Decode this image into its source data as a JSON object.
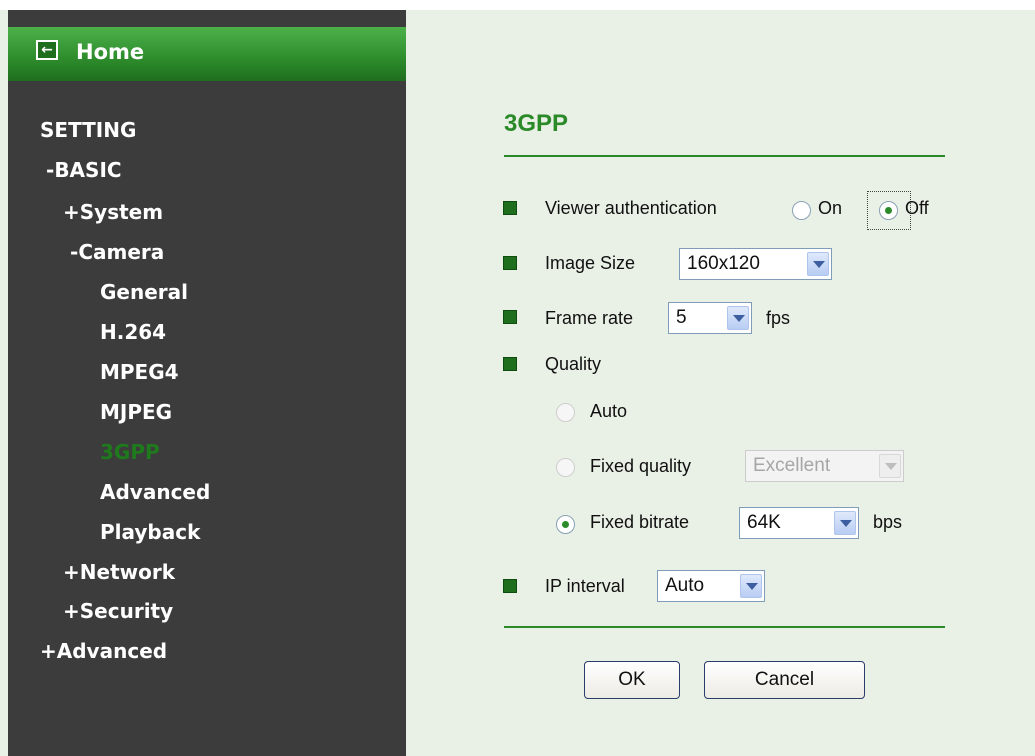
{
  "sidebar": {
    "home_label": "Home",
    "items": [
      {
        "label": "SETTING",
        "prefix": ""
      },
      {
        "label": "BASIC",
        "prefix": "-"
      },
      {
        "label": "System",
        "prefix": "+"
      },
      {
        "label": "Camera",
        "prefix": "-"
      },
      {
        "label": "General",
        "prefix": ""
      },
      {
        "label": "H.264",
        "prefix": ""
      },
      {
        "label": "MPEG4",
        "prefix": ""
      },
      {
        "label": "MJPEG",
        "prefix": ""
      },
      {
        "label": "3GPP",
        "prefix": "",
        "active": true
      },
      {
        "label": "Advanced",
        "prefix": ""
      },
      {
        "label": "Playback",
        "prefix": ""
      },
      {
        "label": "Network",
        "prefix": "+"
      },
      {
        "label": "Security",
        "prefix": "+"
      },
      {
        "label": "Advanced",
        "prefix": "+"
      }
    ]
  },
  "main": {
    "title": "3GPP",
    "viewer_auth": {
      "label": "Viewer authentication",
      "on_label": "On",
      "off_label": "Off",
      "selected": "Off"
    },
    "image_size": {
      "label": "Image Size",
      "value": "160x120"
    },
    "frame_rate": {
      "label": "Frame rate",
      "value": "5",
      "unit": "fps"
    },
    "quality": {
      "label": "Quality",
      "auto_label": "Auto",
      "fixed_quality_label": "Fixed quality",
      "fixed_quality_value": "Excellent",
      "fixed_bitrate_label": "Fixed bitrate",
      "fixed_bitrate_value": "64K",
      "bitrate_unit": "bps",
      "selected": "Fixed bitrate"
    },
    "ip_interval": {
      "label": "IP interval",
      "value": "Auto"
    },
    "ok_label": "OK",
    "cancel_label": "Cancel"
  },
  "colors": {
    "accent_green": "#2a8a28",
    "sidebar_bg": "#3c3c3c",
    "content_bg": "#e9f0e6"
  }
}
